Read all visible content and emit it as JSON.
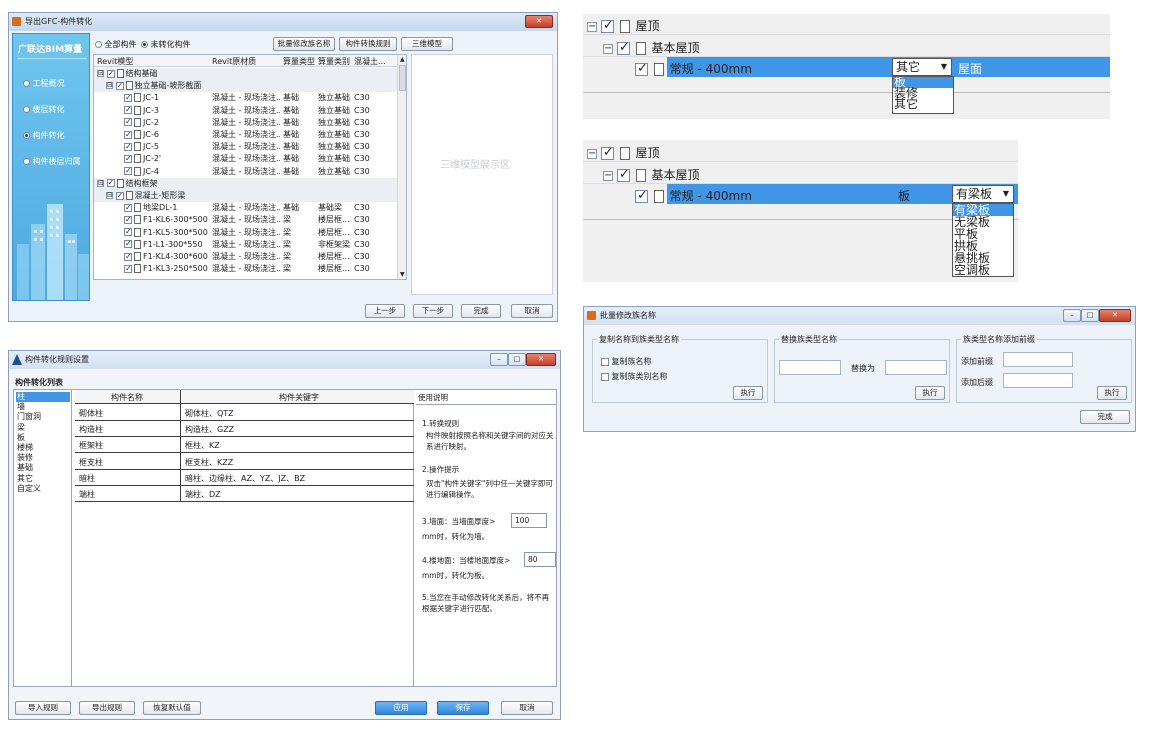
{
  "main_window": {
    "title": "导出GFC-构件转化",
    "brand": "广联达BIM算量",
    "nav": [
      "工程概况",
      "楼层转化",
      "构件转化",
      "构件楼层归属"
    ],
    "nav_selected": 2,
    "filter_all": "全部构件",
    "filter_unconverted": "未转化构件",
    "btn_batch": "批量修改族名称",
    "btn_rules": "构件转换规则",
    "btn_3d": "三维模型",
    "headers": [
      "Revit模型",
      "Revit原材质",
      "算量类型",
      "算量类别",
      "混凝土..."
    ],
    "rows": [
      {
        "level": 0,
        "toggle": "⊟",
        "name": "结构基础",
        "material": "",
        "type": "",
        "cat": "",
        "conc": "",
        "group": true
      },
      {
        "level": 1,
        "toggle": "⊟",
        "name": "独立基础-坡形截面",
        "material": "",
        "type": "",
        "cat": "",
        "conc": "",
        "group": true
      },
      {
        "level": 2,
        "toggle": "",
        "name": "JC-1",
        "material": "混凝土 - 现场浇注...",
        "type": "基础",
        "cat": "独立基础",
        "conc": "C30"
      },
      {
        "level": 2,
        "toggle": "",
        "name": "JC-3",
        "material": "混凝土 - 现场浇注...",
        "type": "基础",
        "cat": "独立基础",
        "conc": "C30"
      },
      {
        "level": 2,
        "toggle": "",
        "name": "JC-2",
        "material": "混凝土 - 现场浇注...",
        "type": "基础",
        "cat": "独立基础",
        "conc": "C30"
      },
      {
        "level": 2,
        "toggle": "",
        "name": "JC-6",
        "material": "混凝土 - 现场浇注...",
        "type": "基础",
        "cat": "独立基础",
        "conc": "C30"
      },
      {
        "level": 2,
        "toggle": "",
        "name": "JC-5",
        "material": "混凝土 - 现场浇注...",
        "type": "基础",
        "cat": "独立基础",
        "conc": "C30"
      },
      {
        "level": 2,
        "toggle": "",
        "name": "JC-2'",
        "material": "混凝土 - 现场浇注...",
        "type": "基础",
        "cat": "独立基础",
        "conc": "C30"
      },
      {
        "level": 2,
        "toggle": "",
        "name": "JC-4",
        "material": "混凝土 - 现场浇注...",
        "type": "基础",
        "cat": "独立基础",
        "conc": "C30"
      },
      {
        "level": 0,
        "toggle": "⊟",
        "name": "结构框架",
        "material": "",
        "type": "",
        "cat": "",
        "conc": "",
        "group": true
      },
      {
        "level": 1,
        "toggle": "⊟",
        "name": "混凝土-矩形梁",
        "material": "",
        "type": "",
        "cat": "",
        "conc": "",
        "group": true
      },
      {
        "level": 2,
        "toggle": "",
        "name": "地梁DL-1",
        "material": "混凝土 - 现场浇注...",
        "type": "基础",
        "cat": "基础梁",
        "conc": "C30"
      },
      {
        "level": 2,
        "toggle": "",
        "name": "F1-KL6-300*500",
        "material": "混凝土 - 现场浇注...",
        "type": "梁",
        "cat": "楼层框...",
        "conc": "C30"
      },
      {
        "level": 2,
        "toggle": "",
        "name": "F1-KL5-300*500",
        "material": "混凝土 - 现场浇注...",
        "type": "梁",
        "cat": "楼层框...",
        "conc": "C30"
      },
      {
        "level": 2,
        "toggle": "",
        "name": "F1-L1-300*550",
        "material": "混凝土 - 现场浇注...",
        "type": "梁",
        "cat": "非框架梁",
        "conc": "C30"
      },
      {
        "level": 2,
        "toggle": "",
        "name": "F1-KL4-300*600",
        "material": "混凝土 - 现场浇注...",
        "type": "梁",
        "cat": "楼层框...",
        "conc": "C30"
      },
      {
        "level": 2,
        "toggle": "",
        "name": "F1-KL3-250*500",
        "material": "混凝土 - 现场浇注...",
        "type": "梁",
        "cat": "楼层框...",
        "conc": "C30"
      }
    ],
    "preview_label": "三维模型展示区",
    "btn_prev": "上一步",
    "btn_next": "下一步",
    "btn_finish": "完成",
    "btn_cancel": "取消"
  },
  "roof_panel_1": {
    "root": "屋顶",
    "child": "基本屋顶",
    "leaf": "常规 - 400mm",
    "dropdown_value": "其它",
    "cat_value": "屋面",
    "options": [
      "板",
      "装修",
      "其它"
    ],
    "highlighted_option": 0
  },
  "roof_panel_2": {
    "root": "屋顶",
    "child": "基本屋顶",
    "leaf": "常规 - 400mm",
    "type_value": "板",
    "dropdown_value": "有梁板",
    "options": [
      "有梁板",
      "无梁板",
      "平板",
      "拱板",
      "悬挑板",
      "空调板"
    ],
    "highlighted_option": 0
  },
  "rules_window": {
    "title": "构件转化规则设置",
    "list_title": "构件转化列表",
    "categories": [
      "柱",
      "墙",
      "门窗洞",
      "梁",
      "板",
      "楼梯",
      "装修",
      "基础",
      "其它",
      "自定义"
    ],
    "selected_category": 0,
    "headers": [
      "构件名称",
      "构件关键字"
    ],
    "rows": [
      {
        "name": "砌体柱",
        "keys": "砌体柱、QTZ"
      },
      {
        "name": "构造柱",
        "keys": "构造柱、GZZ"
      },
      {
        "name": "框架柱",
        "keys": "框柱、KZ"
      },
      {
        "name": "框支柱",
        "keys": "框支柱、KZZ"
      },
      {
        "name": "暗柱",
        "keys": "暗柱、边缘柱、AZ、YZ、JZ、BZ"
      },
      {
        "name": "端柱",
        "keys": "端柱、DZ"
      }
    ],
    "help_title": "使用说明",
    "help_1_title": "1.转换规则",
    "help_1_body": "构件映射按照名称和关键字间的对应关系进行映射。",
    "help_2_title": "2.操作提示",
    "help_2_body": "双击\"构件关键字\"列中任一关键字即可进行编辑操作。",
    "help_3_pre": "3.墙面：当墙面厚度>",
    "help_3_value": "100",
    "help_3_post": "mm时，转化为墙。",
    "help_4_pre": "4.楼地面：当楼地面厚度>",
    "help_4_value": "80",
    "help_4_post": "mm时，转化为板。",
    "help_5": "5.当您在手动修改转化关系后，将不再根据关键字进行匹配。",
    "btn_import": "导入规则",
    "btn_export": "导出规则",
    "btn_reset": "恢复默认值",
    "btn_apply": "应用",
    "btn_save": "保存",
    "btn_cancel": "取消"
  },
  "batch_window": {
    "title": "批量修改族名称",
    "g1_title": "复制名称到族类型名称",
    "g1_opt1": "复制族名称",
    "g1_opt2": "复制族类别名称",
    "g2_title": "替换族类型名称",
    "g2_replace_label": "替换为",
    "g3_title": "族类型名称添加前缀",
    "g3_prefix": "添加前缀",
    "g3_suffix": "添加后缀",
    "btn_exec": "执行",
    "btn_done": "完成"
  }
}
